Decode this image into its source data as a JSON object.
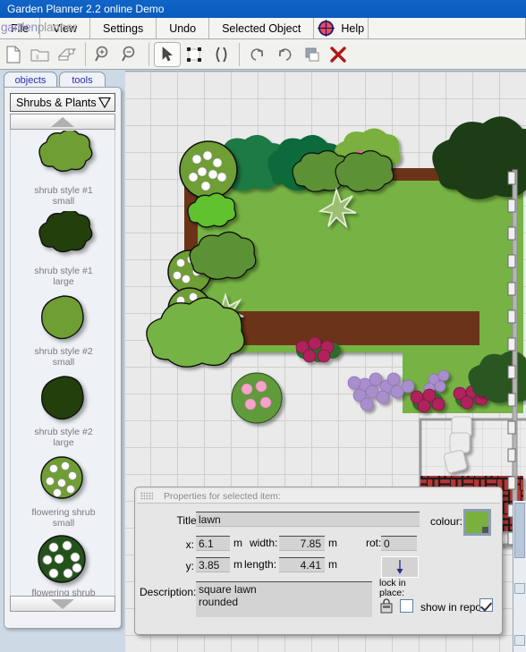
{
  "window": {
    "title": "Garden Planner 2.2 online Demo"
  },
  "menu": {
    "items": [
      {
        "label": "File"
      },
      {
        "label": "View"
      },
      {
        "label": "Settings"
      },
      {
        "label": "Undo"
      },
      {
        "label": "Selected Object"
      },
      {
        "label": "Help"
      }
    ],
    "logo": {
      "part1": "garden",
      "part2": "planner",
      "mark": "gardenplanner-logo-icon"
    }
  },
  "toolbar": {
    "buttons": [
      {
        "name": "new-document-icon",
        "title": "New"
      },
      {
        "name": "open-folder-icon",
        "title": "Open"
      },
      {
        "name": "save-disk-icon",
        "title": "Save"
      },
      {
        "name": "zoom-in-icon",
        "title": "Zoom in"
      },
      {
        "name": "zoom-out-icon",
        "title": "Zoom out"
      },
      {
        "name": "select-arrow-icon",
        "title": "Select",
        "selected": true
      },
      {
        "name": "marquee-select-icon",
        "title": "Marquee select"
      },
      {
        "name": "resize-handles-icon",
        "title": "Resize"
      },
      {
        "name": "rotate-left-icon",
        "title": "Rotate left"
      },
      {
        "name": "rotate-right-icon",
        "title": "Rotate right"
      },
      {
        "name": "arrange-layers-icon",
        "title": "Arrange"
      },
      {
        "name": "delete-x-icon",
        "title": "Delete"
      }
    ]
  },
  "sidebar": {
    "tabs": [
      {
        "label": "objects",
        "selected": true
      },
      {
        "label": "tools",
        "selected": false
      }
    ],
    "category": {
      "label": "Shrubs & Plants",
      "arrow": "chevron-down-icon"
    },
    "scroll_up": "scroll-up-arrow-icon",
    "scroll_down": "scroll-down-arrow-icon",
    "items": [
      {
        "label": "shrub style #1\nsmall",
        "art": "blob-light",
        "color": "#6e9e34"
      },
      {
        "label": "shrub style #1\nlarge",
        "art": "blob-dark",
        "color": "#23400c"
      },
      {
        "label": "shrub style #2\nsmall",
        "art": "round-light",
        "color": "#6e9e34"
      },
      {
        "label": "shrub style #2\nlarge",
        "art": "round-dark",
        "color": "#23400c"
      },
      {
        "label": "flowering shrub\nsmall",
        "art": "flower-light",
        "color": "#6e9e34"
      },
      {
        "label": "flowering shrub",
        "art": "flower-dark",
        "color": "#23521a"
      }
    ]
  },
  "properties": {
    "panel_title": "Properties for selected item:",
    "grip": "drag-grip-icon",
    "title_label": "Title:",
    "title_value": "lawn",
    "x_label": "x:",
    "x_value": "6.1",
    "x_unit": "m",
    "y_label": "y:",
    "y_value": "3.85",
    "y_unit": "m",
    "width_label": "width:",
    "width_value": "7.85",
    "width_unit": "m",
    "length_label": "length:",
    "length_value": "4.41",
    "length_unit": "m",
    "rot_label": "rot:",
    "rot_value": "0",
    "rot_handle_icon": "rotation-handle-icon",
    "description_label": "Description:",
    "description_value": "square lawn\nrounded",
    "colour_label": "colour:",
    "colour_value": "#7ab03d",
    "lock_label": "lock in\nplace:",
    "lock_icon": "padlock-icon",
    "lock_checked": false,
    "report_label": "show in report:",
    "report_checked": true
  },
  "canvas": {
    "grid_size_px": 30,
    "lawn_color": "#76b344",
    "bed_color": "#6b3418",
    "patio_color": "#ebebeb",
    "brick_color": "#b83535",
    "fence": "vertical-fence-right",
    "stepping_stones": 3
  }
}
